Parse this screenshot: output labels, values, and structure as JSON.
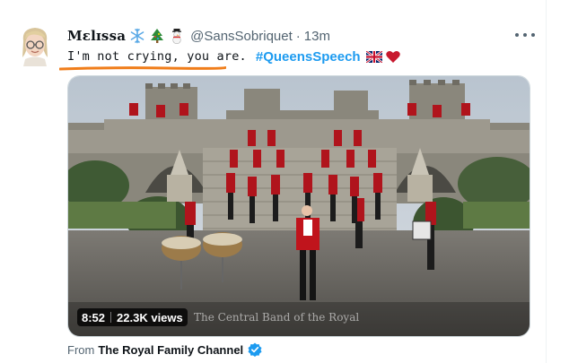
{
  "tweet": {
    "author_name": "Mɛlɪssa",
    "handle": "@SansSobriquet",
    "separator": "·",
    "timestamp": "13m",
    "text_plain": "I'm not crying, you are.",
    "hashtag": "#QueensSpeech",
    "header_emojis": [
      "snowflake-icon",
      "christmas-tree-icon",
      "snowman-icon"
    ],
    "text_emojis": [
      "uk-flag-icon",
      "red-heart-icon"
    ]
  },
  "video": {
    "duration": "8:52",
    "views": "22.3K views",
    "watermark": "The Central Band of the Royal",
    "source_prefix": "From",
    "channel_name": "The Royal Family Channel"
  },
  "colors": {
    "accent": "#1d9bf0",
    "secondary_text": "#536471",
    "annotation_underline": "#f07d1a",
    "band_tunic": "#c0141c"
  }
}
